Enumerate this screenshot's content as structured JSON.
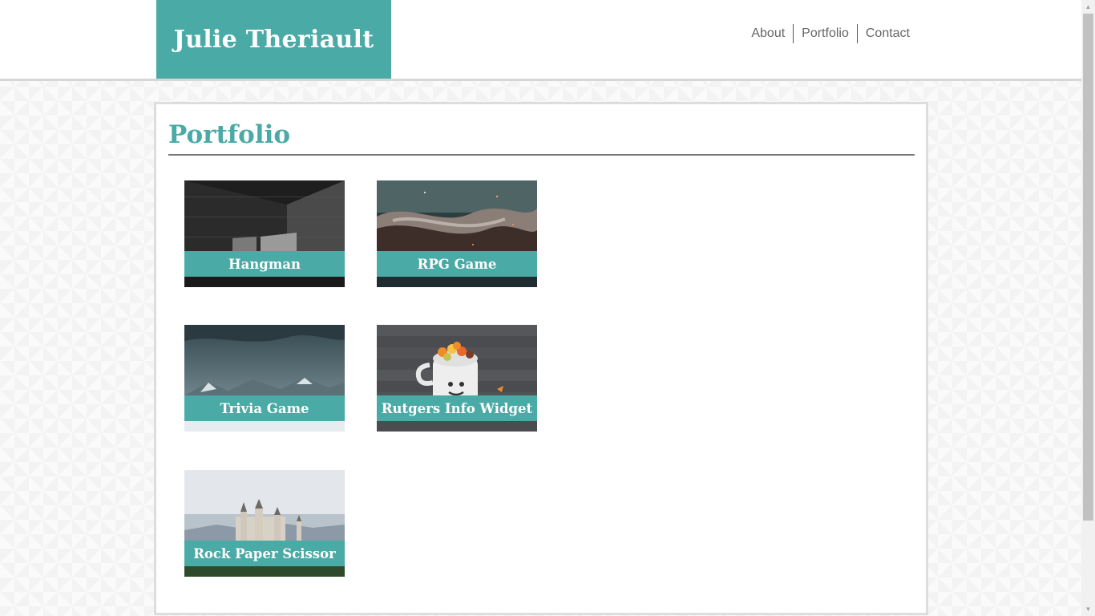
{
  "header": {
    "brand": "Julie Theriault",
    "nav": [
      "About",
      "Portfolio",
      "Contact"
    ]
  },
  "main": {
    "title": "Portfolio",
    "projects": [
      {
        "label": "Hangman",
        "image": "concrete-room"
      },
      {
        "label": "RPG Game",
        "image": "stormy-sky"
      },
      {
        "label": "Trivia Game",
        "image": "snowy-mountains"
      },
      {
        "label": "Rutgers Info Widget",
        "image": "candy-corn-mug"
      },
      {
        "label": "Rock Paper Scissor",
        "image": "castle"
      }
    ]
  },
  "colors": {
    "accent": "#4aaaa5",
    "nav_text": "#666666"
  }
}
